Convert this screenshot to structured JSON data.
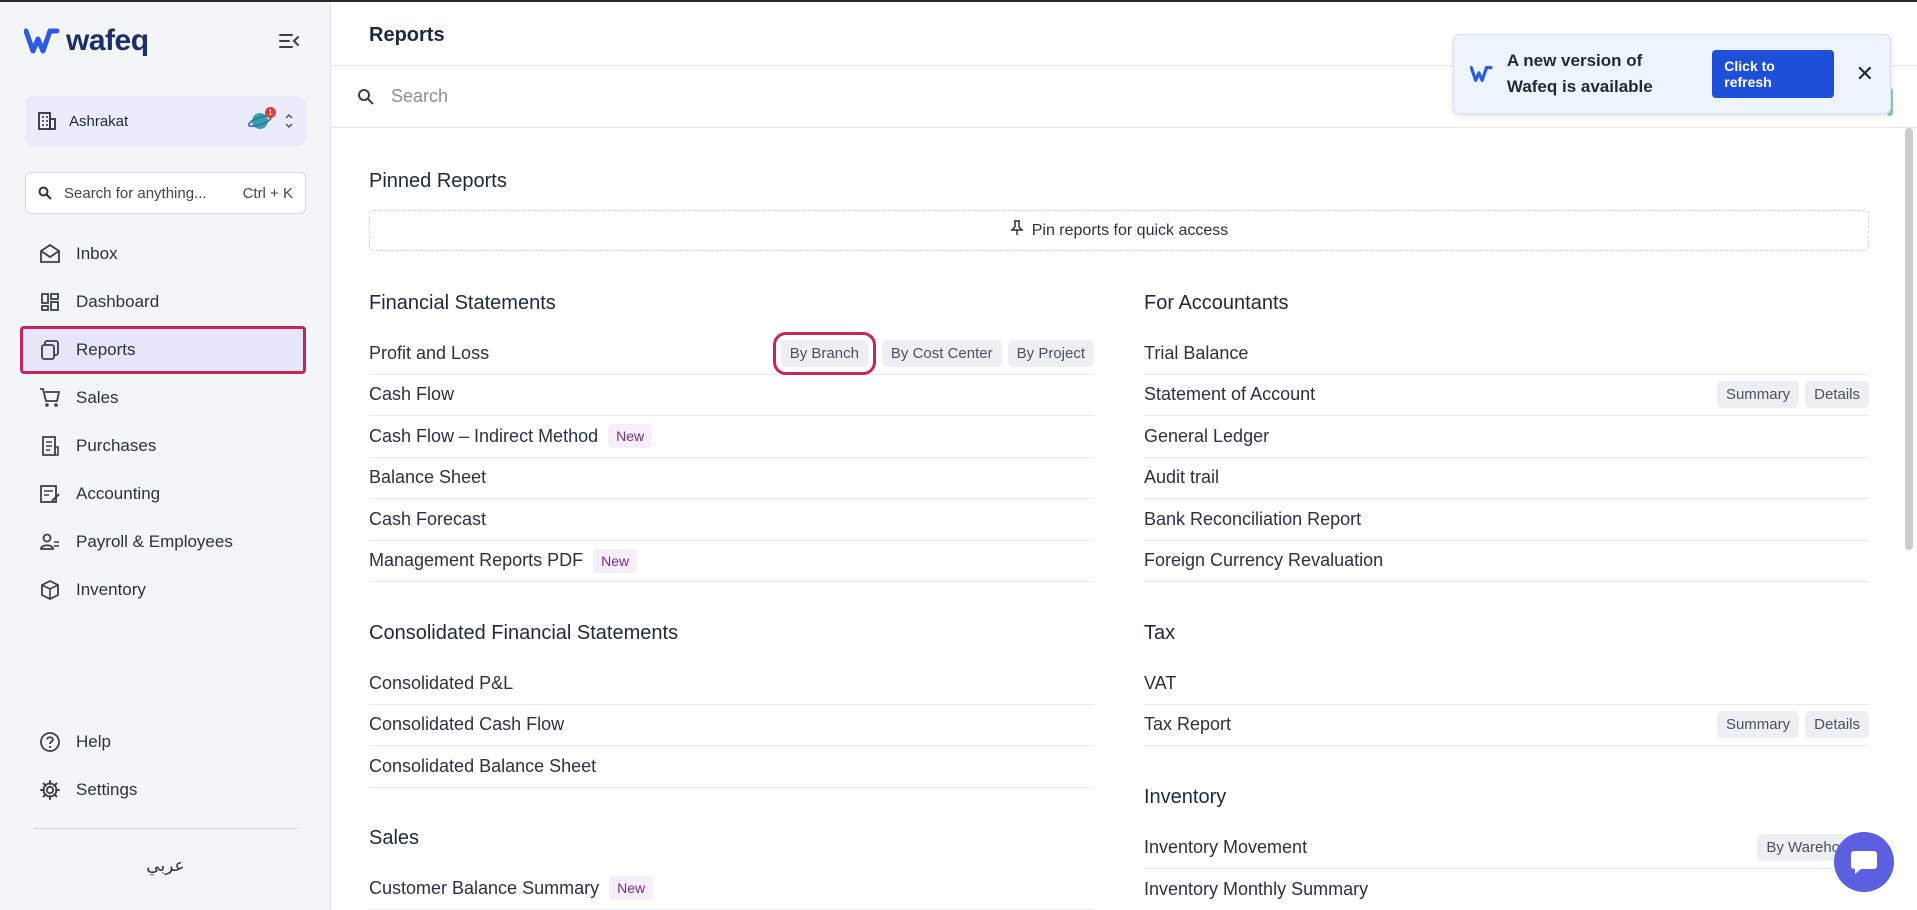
{
  "app": {
    "logo_text": "wafeq"
  },
  "sidebar": {
    "org_name": "Ashrakat",
    "org_badge_count": "1",
    "search_placeholder": "Search for anything...",
    "search_shortcut": "Ctrl + K",
    "items": [
      {
        "label": "Inbox",
        "icon": "inbox-icon"
      },
      {
        "label": "Dashboard",
        "icon": "dashboard-icon"
      },
      {
        "label": "Reports",
        "icon": "reports-icon",
        "active": true
      },
      {
        "label": "Sales",
        "icon": "cart-icon"
      },
      {
        "label": "Purchases",
        "icon": "receipt-icon"
      },
      {
        "label": "Accounting",
        "icon": "ledger-icon"
      },
      {
        "label": "Payroll & Employees",
        "icon": "people-icon"
      },
      {
        "label": "Inventory",
        "icon": "box-icon"
      }
    ],
    "bottom_items": [
      {
        "label": "Help",
        "icon": "help-icon"
      },
      {
        "label": "Settings",
        "icon": "gear-icon"
      }
    ],
    "language_switch": "عربي"
  },
  "header": {
    "title": "Reports",
    "search_placeholder": "Search"
  },
  "toast": {
    "message": "A new version of Wafeq is available",
    "button": "Click to refresh"
  },
  "pinned": {
    "title": "Pinned Reports",
    "empty_text": "Pin reports for quick access"
  },
  "sections": {
    "financial": {
      "title": "Financial Statements",
      "rows": [
        {
          "name": "Profit and Loss",
          "chips": [
            "By Branch",
            "By Cost Center",
            "By Project"
          ]
        },
        {
          "name": "Cash Flow"
        },
        {
          "name": "Cash Flow – Indirect Method",
          "badge": "New"
        },
        {
          "name": "Balance Sheet"
        },
        {
          "name": "Cash Forecast"
        },
        {
          "name": "Management Reports PDF",
          "badge": "New"
        }
      ]
    },
    "consolidated": {
      "title": "Consolidated Financial Statements",
      "rows": [
        {
          "name": "Consolidated P&L"
        },
        {
          "name": "Consolidated Cash Flow"
        },
        {
          "name": "Consolidated Balance Sheet"
        }
      ]
    },
    "sales": {
      "title": "Sales",
      "rows": [
        {
          "name": "Customer Balance Summary",
          "badge": "New"
        }
      ]
    },
    "accountants": {
      "title": "For Accountants",
      "rows": [
        {
          "name": "Trial Balance"
        },
        {
          "name": "Statement of Account",
          "chips": [
            "Summary",
            "Details"
          ]
        },
        {
          "name": "General Ledger"
        },
        {
          "name": "Audit trail"
        },
        {
          "name": "Bank Reconciliation Report"
        },
        {
          "name": "Foreign Currency Revaluation"
        }
      ]
    },
    "tax": {
      "title": "Tax",
      "rows": [
        {
          "name": "VAT"
        },
        {
          "name": "Tax Report",
          "chips": [
            "Summary",
            "Details"
          ]
        }
      ]
    },
    "inventory": {
      "title": "Inventory",
      "rows": [
        {
          "name": "Inventory Movement",
          "chips": [
            "By Wareho"
          ]
        },
        {
          "name": "Inventory Monthly Summary"
        }
      ]
    }
  },
  "colors": {
    "highlight": "#c8245a",
    "primary": "#1d4fd8",
    "brand": "#1d2e6b",
    "chat": "#5b5fe0"
  }
}
